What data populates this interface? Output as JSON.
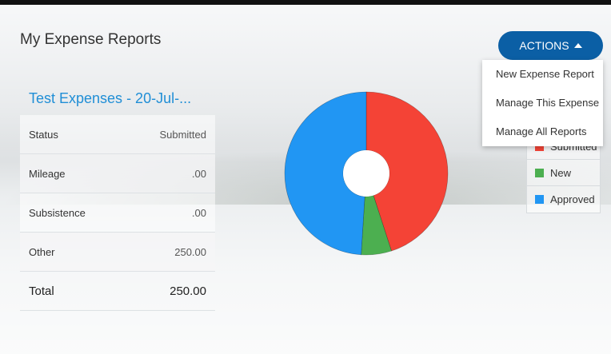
{
  "page": {
    "title": "My Expense Reports"
  },
  "actions": {
    "label": "ACTIONS",
    "menu": [
      {
        "label": "New Expense Report"
      },
      {
        "label": "Manage This Expense"
      },
      {
        "label": "Manage All Reports"
      }
    ]
  },
  "report": {
    "title": "Test Expenses - 20-Jul-...",
    "rows": [
      {
        "label": "Status",
        "value": "Submitted"
      },
      {
        "label": "Mileage",
        "value": ".00"
      },
      {
        "label": "Subsistence",
        "value": ".00"
      },
      {
        "label": "Other",
        "value": "250.00"
      }
    ],
    "total": {
      "label": "Total",
      "value": "250.00"
    }
  },
  "colors": {
    "accent": "#0b5fa5",
    "link": "#1f8ed6",
    "submitted": "#f44336",
    "new": "#4caf50",
    "approved": "#2196f3"
  },
  "chart_data": {
    "type": "pie",
    "donut": true,
    "series": [
      {
        "name": "Submitted",
        "value": 45,
        "color": "#f44336"
      },
      {
        "name": "New",
        "value": 6,
        "color": "#4caf50"
      },
      {
        "name": "Approved",
        "value": 49,
        "color": "#2196f3"
      }
    ],
    "legend_position": "right"
  }
}
